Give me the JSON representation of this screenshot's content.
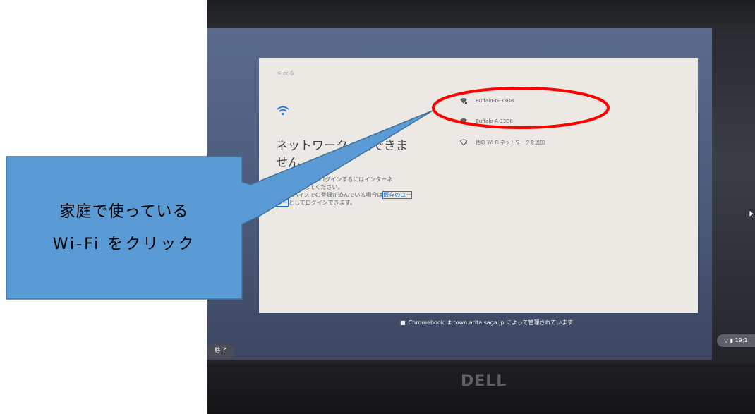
{
  "dialog": {
    "back_label": "< 戻る",
    "title": "ネットワークを使用できません",
    "title_visible_line1": "ネットワーク　用できま",
    "title_visible_line2": "せん",
    "text_line1": "Chromebook にログインするにはインターネ",
    "text_line2": "ットに接続してください。",
    "text_line3a": "このデバイスでの登録が済んでいる場合は",
    "text_line3_link": "既存のユー",
    "text_line4_link": "ザー",
    "text_line4b": "としてログインできます。"
  },
  "networks": [
    {
      "name": "Buffalo-G-33D8",
      "icon": "wifi-lock-icon"
    },
    {
      "name": "Buffalo-A-33D8",
      "icon": "wifi-lock-icon"
    },
    {
      "name": "他の Wi-Fi ネットワークを追加",
      "icon": "wifi-add-icon"
    }
  ],
  "managed_notice": "Chromebook は town.arita.saga.jp によって管理されています",
  "shelf": {
    "exit_label": "終了",
    "time": "19:1"
  },
  "laptop_brand": "DELL",
  "callout": {
    "line1": "家庭で使っている",
    "line2": "Wi-Fi をクリック"
  },
  "colors": {
    "callout_fill": "#5b9bd5",
    "callout_stroke": "#41719c",
    "annotation_ellipse": "#ff0000",
    "link": "#1a73e8"
  }
}
